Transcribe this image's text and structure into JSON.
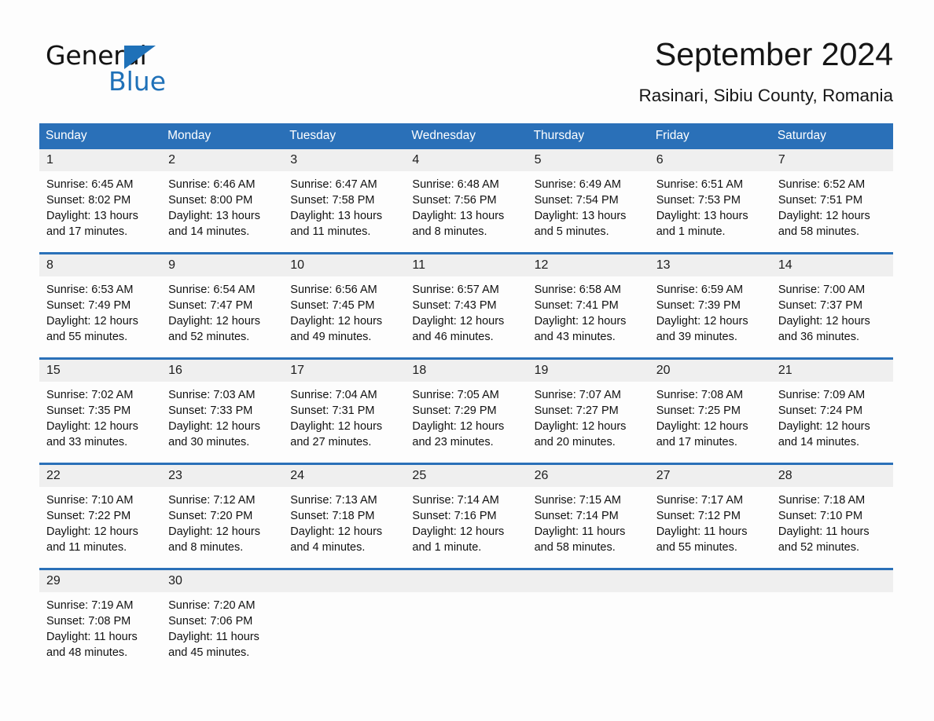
{
  "brand": {
    "name_part1": "General",
    "name_part2": "Blue",
    "accent_color": "#1f71b8"
  },
  "header": {
    "title": "September 2024",
    "location": "Rasinari, Sibiu County, Romania"
  },
  "calendar": {
    "header_bg": "#2a70b8",
    "daynum_bg": "#efefef",
    "weekday_headers": [
      "Sunday",
      "Monday",
      "Tuesday",
      "Wednesday",
      "Thursday",
      "Friday",
      "Saturday"
    ],
    "weeks": [
      [
        {
          "day": "1",
          "sunrise": "Sunrise: 6:45 AM",
          "sunset": "Sunset: 8:02 PM",
          "daylight": "Daylight: 13 hours and 17 minutes."
        },
        {
          "day": "2",
          "sunrise": "Sunrise: 6:46 AM",
          "sunset": "Sunset: 8:00 PM",
          "daylight": "Daylight: 13 hours and 14 minutes."
        },
        {
          "day": "3",
          "sunrise": "Sunrise: 6:47 AM",
          "sunset": "Sunset: 7:58 PM",
          "daylight": "Daylight: 13 hours and 11 minutes."
        },
        {
          "day": "4",
          "sunrise": "Sunrise: 6:48 AM",
          "sunset": "Sunset: 7:56 PM",
          "daylight": "Daylight: 13 hours and 8 minutes."
        },
        {
          "day": "5",
          "sunrise": "Sunrise: 6:49 AM",
          "sunset": "Sunset: 7:54 PM",
          "daylight": "Daylight: 13 hours and 5 minutes."
        },
        {
          "day": "6",
          "sunrise": "Sunrise: 6:51 AM",
          "sunset": "Sunset: 7:53 PM",
          "daylight": "Daylight: 13 hours and 1 minute."
        },
        {
          "day": "7",
          "sunrise": "Sunrise: 6:52 AM",
          "sunset": "Sunset: 7:51 PM",
          "daylight": "Daylight: 12 hours and 58 minutes."
        }
      ],
      [
        {
          "day": "8",
          "sunrise": "Sunrise: 6:53 AM",
          "sunset": "Sunset: 7:49 PM",
          "daylight": "Daylight: 12 hours and 55 minutes."
        },
        {
          "day": "9",
          "sunrise": "Sunrise: 6:54 AM",
          "sunset": "Sunset: 7:47 PM",
          "daylight": "Daylight: 12 hours and 52 minutes."
        },
        {
          "day": "10",
          "sunrise": "Sunrise: 6:56 AM",
          "sunset": "Sunset: 7:45 PM",
          "daylight": "Daylight: 12 hours and 49 minutes."
        },
        {
          "day": "11",
          "sunrise": "Sunrise: 6:57 AM",
          "sunset": "Sunset: 7:43 PM",
          "daylight": "Daylight: 12 hours and 46 minutes."
        },
        {
          "day": "12",
          "sunrise": "Sunrise: 6:58 AM",
          "sunset": "Sunset: 7:41 PM",
          "daylight": "Daylight: 12 hours and 43 minutes."
        },
        {
          "day": "13",
          "sunrise": "Sunrise: 6:59 AM",
          "sunset": "Sunset: 7:39 PM",
          "daylight": "Daylight: 12 hours and 39 minutes."
        },
        {
          "day": "14",
          "sunrise": "Sunrise: 7:00 AM",
          "sunset": "Sunset: 7:37 PM",
          "daylight": "Daylight: 12 hours and 36 minutes."
        }
      ],
      [
        {
          "day": "15",
          "sunrise": "Sunrise: 7:02 AM",
          "sunset": "Sunset: 7:35 PM",
          "daylight": "Daylight: 12 hours and 33 minutes."
        },
        {
          "day": "16",
          "sunrise": "Sunrise: 7:03 AM",
          "sunset": "Sunset: 7:33 PM",
          "daylight": "Daylight: 12 hours and 30 minutes."
        },
        {
          "day": "17",
          "sunrise": "Sunrise: 7:04 AM",
          "sunset": "Sunset: 7:31 PM",
          "daylight": "Daylight: 12 hours and 27 minutes."
        },
        {
          "day": "18",
          "sunrise": "Sunrise: 7:05 AM",
          "sunset": "Sunset: 7:29 PM",
          "daylight": "Daylight: 12 hours and 23 minutes."
        },
        {
          "day": "19",
          "sunrise": "Sunrise: 7:07 AM",
          "sunset": "Sunset: 7:27 PM",
          "daylight": "Daylight: 12 hours and 20 minutes."
        },
        {
          "day": "20",
          "sunrise": "Sunrise: 7:08 AM",
          "sunset": "Sunset: 7:25 PM",
          "daylight": "Daylight: 12 hours and 17 minutes."
        },
        {
          "day": "21",
          "sunrise": "Sunrise: 7:09 AM",
          "sunset": "Sunset: 7:24 PM",
          "daylight": "Daylight: 12 hours and 14 minutes."
        }
      ],
      [
        {
          "day": "22",
          "sunrise": "Sunrise: 7:10 AM",
          "sunset": "Sunset: 7:22 PM",
          "daylight": "Daylight: 12 hours and 11 minutes."
        },
        {
          "day": "23",
          "sunrise": "Sunrise: 7:12 AM",
          "sunset": "Sunset: 7:20 PM",
          "daylight": "Daylight: 12 hours and 8 minutes."
        },
        {
          "day": "24",
          "sunrise": "Sunrise: 7:13 AM",
          "sunset": "Sunset: 7:18 PM",
          "daylight": "Daylight: 12 hours and 4 minutes."
        },
        {
          "day": "25",
          "sunrise": "Sunrise: 7:14 AM",
          "sunset": "Sunset: 7:16 PM",
          "daylight": "Daylight: 12 hours and 1 minute."
        },
        {
          "day": "26",
          "sunrise": "Sunrise: 7:15 AM",
          "sunset": "Sunset: 7:14 PM",
          "daylight": "Daylight: 11 hours and 58 minutes."
        },
        {
          "day": "27",
          "sunrise": "Sunrise: 7:17 AM",
          "sunset": "Sunset: 7:12 PM",
          "daylight": "Daylight: 11 hours and 55 minutes."
        },
        {
          "day": "28",
          "sunrise": "Sunrise: 7:18 AM",
          "sunset": "Sunset: 7:10 PM",
          "daylight": "Daylight: 11 hours and 52 minutes."
        }
      ],
      [
        {
          "day": "29",
          "sunrise": "Sunrise: 7:19 AM",
          "sunset": "Sunset: 7:08 PM",
          "daylight": "Daylight: 11 hours and 48 minutes."
        },
        {
          "day": "30",
          "sunrise": "Sunrise: 7:20 AM",
          "sunset": "Sunset: 7:06 PM",
          "daylight": "Daylight: 11 hours and 45 minutes."
        },
        {
          "day": "",
          "sunrise": "",
          "sunset": "",
          "daylight": ""
        },
        {
          "day": "",
          "sunrise": "",
          "sunset": "",
          "daylight": ""
        },
        {
          "day": "",
          "sunrise": "",
          "sunset": "",
          "daylight": ""
        },
        {
          "day": "",
          "sunrise": "",
          "sunset": "",
          "daylight": ""
        },
        {
          "day": "",
          "sunrise": "",
          "sunset": "",
          "daylight": ""
        }
      ]
    ]
  }
}
